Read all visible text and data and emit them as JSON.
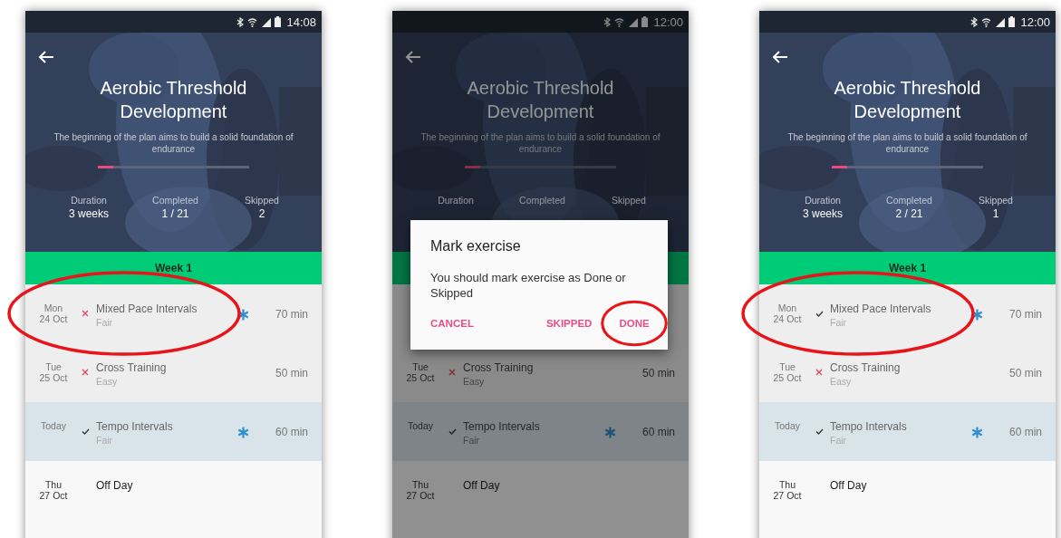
{
  "phones": [
    {
      "status_time": "14:08",
      "dimmed": false,
      "header": {
        "title": "Aerobic Threshold Development",
        "description": "The beginning of the plan aims to build a solid foundation of endurance",
        "level": 0.1
      },
      "stats": [
        {
          "label": "Duration",
          "value": "3 weeks"
        },
        {
          "label": "Completed",
          "value": "1 / 21"
        },
        {
          "label": "Skipped",
          "value": "2"
        }
      ],
      "week_label": "Week 1",
      "rows": [
        {
          "kind": "past",
          "day": "Mon",
          "date": "24 Oct",
          "done": false,
          "title": "Mixed Pace Intervals",
          "subtitle": "Fair",
          "starred": true,
          "duration": "70 min",
          "highlighted": true
        },
        {
          "kind": "past",
          "day": "Tue",
          "date": "25 Oct",
          "done": false,
          "title": "Cross Training",
          "subtitle": "Easy",
          "starred": false,
          "duration": "50 min",
          "highlighted": false
        },
        {
          "kind": "today",
          "day": "Today",
          "done": true,
          "title": "Tempo Intervals",
          "subtitle": "Fair",
          "starred": true,
          "duration": "60 min",
          "highlighted": false
        },
        {
          "kind": "future",
          "day": "Thu",
          "date": "27 Oct",
          "title": "Off Day",
          "starred": false,
          "highlighted": false
        }
      ]
    },
    {
      "status_time": "12:00",
      "dimmed": true,
      "header": {
        "title": "Aerobic Threshold Development",
        "description": "The beginning of the plan aims to build a solid foundation of endurance",
        "level": 0.1
      },
      "stats": [
        {
          "label": "Duration"
        },
        {
          "label": "Completed"
        },
        {
          "label": "Skipped"
        }
      ],
      "rows": [
        {
          "kind": "past"
        },
        {
          "kind": "past",
          "day": "Tue",
          "date": "25 Oct",
          "done": false,
          "title": "Cross Training",
          "subtitle": "Easy",
          "starred": false,
          "duration": "50 min",
          "highlighted": false
        },
        {
          "kind": "today",
          "day": "Today",
          "done": true,
          "title": "Tempo Intervals",
          "subtitle": "Fair",
          "starred": true,
          "duration": "60 min",
          "highlighted": false
        },
        {
          "kind": "future",
          "day": "Thu",
          "date": "27 Oct",
          "title": "Off Day",
          "starred": false,
          "highlighted": false
        }
      ],
      "dialog": {
        "title": "Mark exercise",
        "message": "You should mark exercise as Done or Skipped",
        "buttons": [
          {
            "label": "CANCEL",
            "highlighted": false
          },
          {
            "label": "SKIPPED",
            "highlighted": false
          },
          {
            "label": "DONE",
            "highlighted": true
          }
        ]
      }
    },
    {
      "status_time": "12:00",
      "dimmed": false,
      "header": {
        "title": "Aerobic Threshold Development",
        "description": "The beginning of the plan aims to build a solid foundation of endurance",
        "level": 0.1
      },
      "stats": [
        {
          "label": "Duration",
          "value": "3 weeks"
        },
        {
          "label": "Completed",
          "value": "2 / 21"
        },
        {
          "label": "Skipped",
          "value": "1"
        }
      ],
      "week_label": "Week 1",
      "rows": [
        {
          "kind": "past",
          "day": "Mon",
          "date": "24 Oct",
          "done": true,
          "title": "Mixed Pace Intervals",
          "subtitle": "Fair",
          "starred": true,
          "duration": "70 min",
          "highlighted": true
        },
        {
          "kind": "past",
          "day": "Tue",
          "date": "25 Oct",
          "done": false,
          "title": "Cross Training",
          "subtitle": "Easy",
          "starred": false,
          "duration": "50 min",
          "highlighted": false
        },
        {
          "kind": "today",
          "day": "Today",
          "done": true,
          "title": "Tempo Intervals",
          "subtitle": "Fair",
          "starred": true,
          "duration": "60 min",
          "highlighted": false
        },
        {
          "kind": "future",
          "day": "Thu",
          "date": "27 Oct",
          "title": "Off Day",
          "starred": false,
          "highlighted": false
        }
      ]
    }
  ]
}
